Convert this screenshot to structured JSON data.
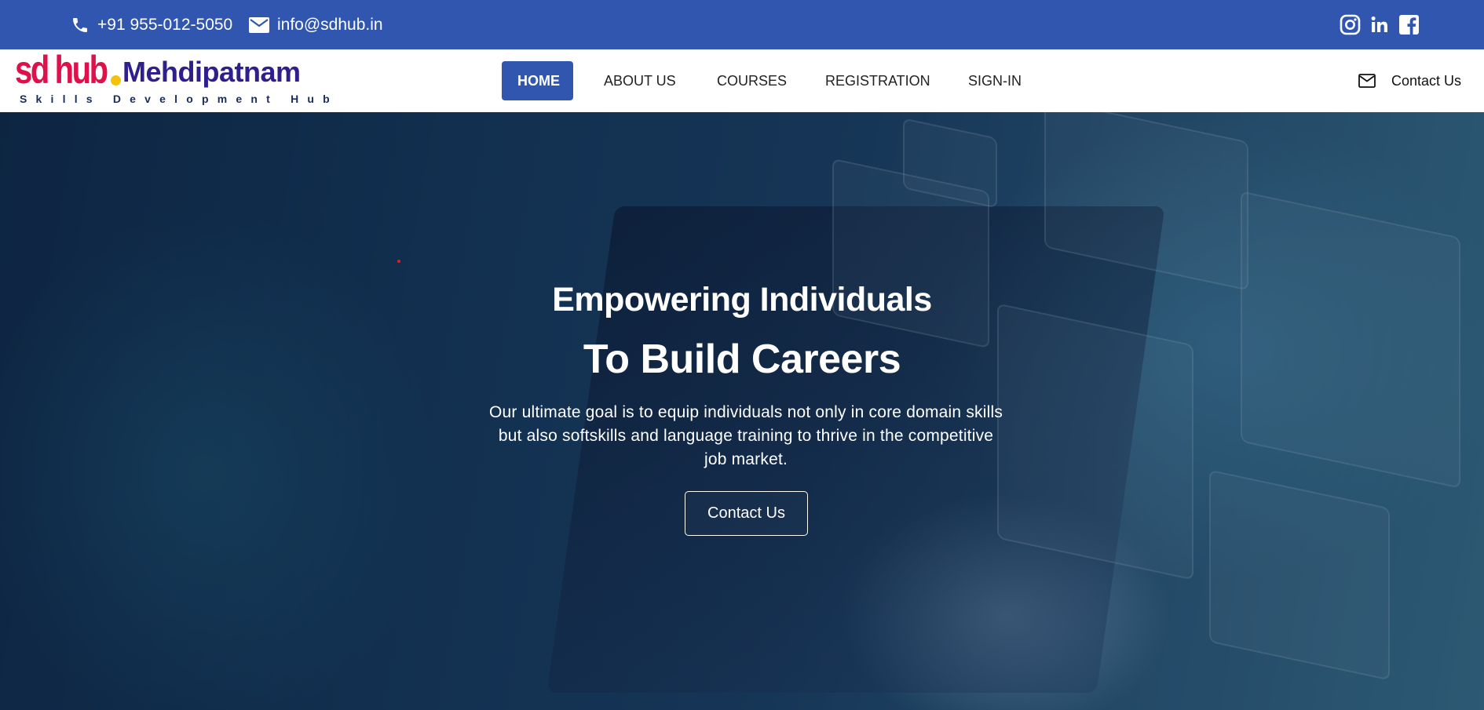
{
  "topbar": {
    "phone": "+91 955-012-5050",
    "email": "info@sdhub.in",
    "social": [
      "instagram-icon",
      "linkedin-icon",
      "facebook-icon"
    ]
  },
  "logo": {
    "brand": "sd hub",
    "location": "Mehdipatnam",
    "tagline": "Skills Development Hub"
  },
  "nav": {
    "items": [
      {
        "label": "HOME",
        "active": true
      },
      {
        "label": "ABOUT US"
      },
      {
        "label": "COURSES"
      },
      {
        "label": "REGISTRATION"
      },
      {
        "label": "SIGN-IN"
      }
    ],
    "contact_label": "Contact Us"
  },
  "hero": {
    "line1": "Empowering Individuals",
    "line2": "To Build Careers",
    "description": "Our ultimate goal is to equip individuals not only in core domain skills but also softskills and language training to thrive in the competitive job market.",
    "button": "Contact Us"
  },
  "colors": {
    "primary": "#3056b0",
    "logo_red": "#e0104a",
    "logo_purple": "#2e1f8c",
    "logo_dot": "#f4c20d"
  }
}
